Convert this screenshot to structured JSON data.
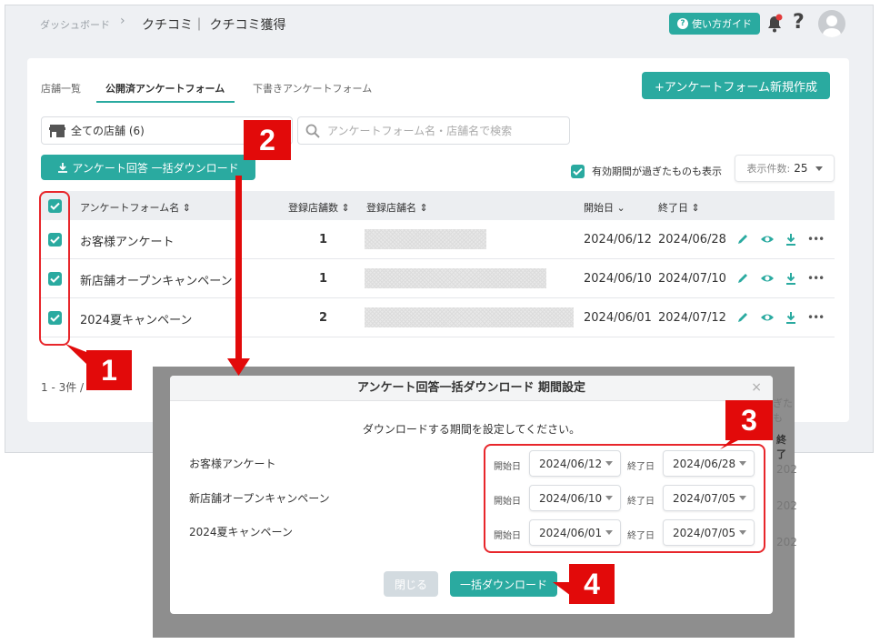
{
  "header": {
    "breadcrumb_dashboard": "ダッシュボード",
    "breadcrumb_sep": "›",
    "page_title": "クチコミ｜ クチコミ獲得",
    "guide_label": "使い方ガイド"
  },
  "tabs": [
    {
      "label": "店舗一覧",
      "active": false
    },
    {
      "label": "公開済アンケートフォーム",
      "active": true
    },
    {
      "label": "下書きアンケートフォーム",
      "active": false
    }
  ],
  "toolbar": {
    "new_form_label": "+アンケートフォーム新規作成",
    "store_select": "全ての店舗 (6)",
    "search_placeholder": "アンケートフォーム名・店舗名で検索",
    "bulk_download_label": "アンケート回答 一括ダウンロード",
    "show_expired_label": "有効期間が過ぎたものも表示",
    "per_page_label": "表示件数:",
    "per_page_value": "25"
  },
  "table": {
    "columns": [
      "アンケートフォーム名",
      "登録店舗数",
      "登録店舗名",
      "開始日",
      "終了日"
    ],
    "rows": [
      {
        "name": "お客様アンケート",
        "count": "1",
        "start": "2024/06/12",
        "end": "2024/06/28"
      },
      {
        "name": "新店舗オープンキャンペーン",
        "count": "1",
        "start": "2024/06/10",
        "end": "2024/07/10"
      },
      {
        "name": "2024夏キャンペーン",
        "count": "2",
        "start": "2024/06/01",
        "end": "2024/07/12"
      }
    ],
    "pager": "1 - 3件 /"
  },
  "background_peek": {
    "expired_fragment": "ぎたも",
    "end_col_fragment": "終了",
    "row_fragment": "202"
  },
  "dialog": {
    "title": "アンケート回答一括ダウンロード 期間設定",
    "message": "ダウンロードする期間を設定してください。",
    "start_label": "開始日",
    "end_label": "終了日",
    "rows": [
      {
        "name": "お客様アンケート",
        "start": "2024/06/12",
        "end": "2024/06/28"
      },
      {
        "name": "新店舗オープンキャンペーン",
        "start": "2024/06/10",
        "end": "2024/07/05"
      },
      {
        "name": "2024夏キャンペーン",
        "start": "2024/06/01",
        "end": "2024/07/05"
      }
    ],
    "close_label": "閉じる",
    "bulk_label": "一括ダウンロード"
  },
  "annotations": {
    "step1": "1",
    "step2": "2",
    "step3": "3",
    "step4": "4"
  },
  "colors": {
    "accent": "#2aaaa0",
    "annotation_red": "#e20a0a"
  }
}
